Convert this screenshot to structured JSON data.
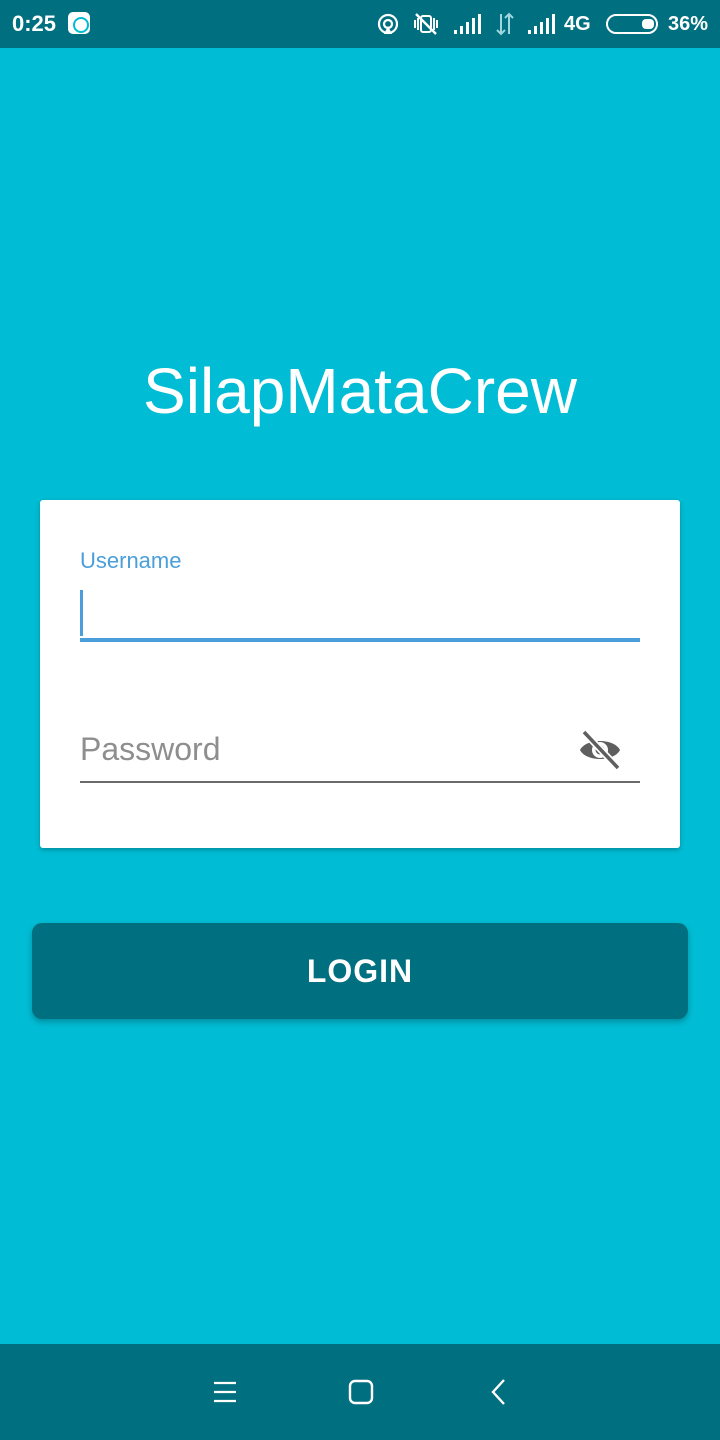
{
  "status_bar": {
    "time": "0:25",
    "network": "4G",
    "battery": "36%",
    "icons": [
      "app-notification-icon",
      "hotspot-icon",
      "vibrate-off-icon",
      "signal-icon",
      "data-transfer-icon",
      "signal-icon",
      "battery-icon"
    ]
  },
  "app": {
    "title": "SilapMataCrew"
  },
  "login_form": {
    "username_label": "Username",
    "username_value": "",
    "password_placeholder": "Password",
    "password_value": "",
    "password_toggle_icon": "visibility-off-icon",
    "login_button": "LOGIN"
  },
  "nav_bar": {
    "icons": [
      "menu-icon",
      "home-icon",
      "back-icon"
    ]
  },
  "colors": {
    "background": "#00BCD4",
    "primary_dark": "#006F7F",
    "accent": "#4A9FDA",
    "card": "#FFFFFF"
  }
}
